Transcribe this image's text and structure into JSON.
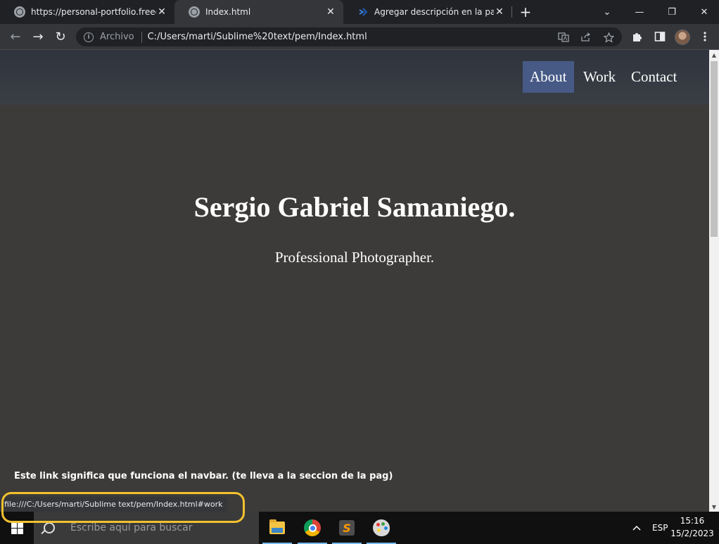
{
  "browser": {
    "tabs": [
      {
        "title": "https://personal-portfolio.freecodecamp",
        "icon": "globe-icon",
        "active": false
      },
      {
        "title": "Index.html",
        "icon": "globe-icon",
        "active": true
      },
      {
        "title": "Agregar descripción en la parte inferior",
        "icon": "vscode-icon",
        "active": false
      }
    ],
    "new_tab": "+",
    "window_controls": {
      "tab_search": "⌄",
      "minimize": "—",
      "restore": "❐",
      "close": "✕"
    },
    "toolbar": {
      "back": "←",
      "forward": "→",
      "reload": "↻",
      "scheme_label": "Archivo",
      "url": "C:/Users/marti/Sublime%20text/pem/Index.html"
    },
    "status_url": "file:///C:/Users/marti/Sublime text/pem/Index.html#work"
  },
  "page": {
    "nav": [
      {
        "label": "About",
        "active": true
      },
      {
        "label": "Work",
        "active": false
      },
      {
        "label": "Contact",
        "active": false
      }
    ],
    "hero_title": "Sergio Gabriel Samaniego.",
    "hero_subtitle": "Professional Photographer.",
    "annotation": "Este link significa que funciona el navbar. (te lleva a la seccion de la pag)"
  },
  "taskbar": {
    "search_placeholder": "Escribe aquí para buscar",
    "apps": [
      "file-explorer-icon",
      "chrome-icon",
      "sublime-text-icon",
      "paint-icon"
    ],
    "language": "ESP",
    "time": "15:16",
    "date": "15/2/2023"
  },
  "colors": {
    "page_bg": "#3d3b39",
    "navbar_bg": "#2f343d",
    "nav_active_bg": "#475a86",
    "highlight_ring": "#f2c12e"
  }
}
